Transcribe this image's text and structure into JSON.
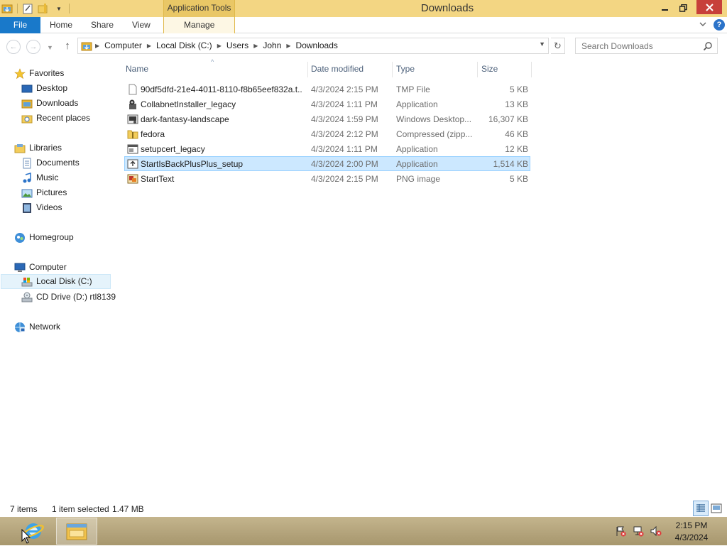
{
  "window": {
    "title": "Downloads",
    "contextual_tab": "Application Tools"
  },
  "ribbon": {
    "tabs": [
      {
        "label": "File"
      },
      {
        "label": "Home"
      },
      {
        "label": "Share"
      },
      {
        "label": "View"
      },
      {
        "label": "Manage"
      }
    ]
  },
  "address": {
    "breadcrumbs": [
      "Computer",
      "Local Disk (C:)",
      "Users",
      "John",
      "Downloads"
    ]
  },
  "search": {
    "placeholder": "Search Downloads"
  },
  "nav": {
    "favorites": "Favorites",
    "desktop": "Desktop",
    "downloads": "Downloads",
    "recent": "Recent places",
    "libraries": "Libraries",
    "documents": "Documents",
    "music": "Music",
    "pictures": "Pictures",
    "videos": "Videos",
    "homegroup": "Homegroup",
    "computer": "Computer",
    "local_disk": "Local Disk (C:)",
    "cd_drive": "CD Drive (D:) rtl8139",
    "network": "Network"
  },
  "columns": {
    "name": "Name",
    "date": "Date modified",
    "type": "Type",
    "size": "Size"
  },
  "files": [
    {
      "name": "90df5dfd-21e4-4011-8110-f8b65eef832a.t...",
      "date": "4/3/2024 2:15 PM",
      "type": "TMP File",
      "size": "5 KB",
      "icon": "blank-file-icon"
    },
    {
      "name": "CollabnetInstaller_legacy",
      "date": "4/3/2024 1:11 PM",
      "type": "Application",
      "size": "13 KB",
      "icon": "installer-icon"
    },
    {
      "name": "dark-fantasy-landscape",
      "date": "4/3/2024 1:59 PM",
      "type": "Windows Desktop...",
      "size": "16,307 KB",
      "icon": "theme-icon"
    },
    {
      "name": "fedora",
      "date": "4/3/2024 2:12 PM",
      "type": "Compressed (zipp...",
      "size": "46 KB",
      "icon": "zip-folder-icon"
    },
    {
      "name": "setupcert_legacy",
      "date": "4/3/2024 1:11 PM",
      "type": "Application",
      "size": "12 KB",
      "icon": "application-icon"
    },
    {
      "name": "StartIsBackPlusPlus_setup",
      "date": "4/3/2024 2:00 PM",
      "type": "Application",
      "size": "1,514 KB",
      "icon": "setup-icon",
      "selected": true
    },
    {
      "name": "StartText",
      "date": "4/3/2024 2:15 PM",
      "type": "PNG image",
      "size": "5 KB",
      "icon": "png-image-icon"
    }
  ],
  "status": {
    "items": "7 items",
    "selected": "1 item selected",
    "size": "1.47 MB"
  },
  "clock": {
    "time": "2:15 PM",
    "date": "4/3/2024"
  }
}
